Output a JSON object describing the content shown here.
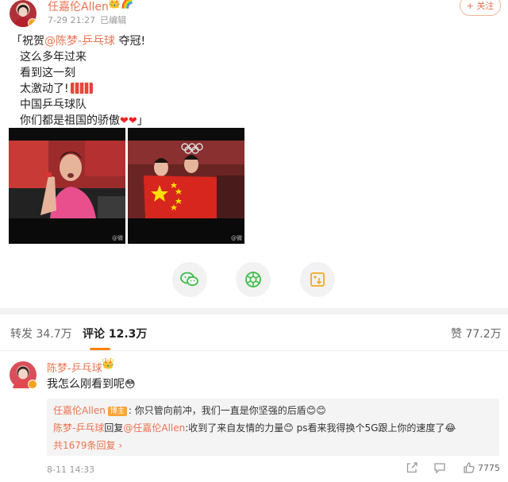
{
  "post": {
    "author": "任嘉伦Allen",
    "author_badges": "👑🌈",
    "time": "7-29 21:27",
    "edited": "已编辑",
    "follow_label": "+ 关注",
    "text_lines": [
      {
        "before": "「祝贺",
        "mention": "@陈梦-乒乓球",
        "after": " 夺冠!"
      },
      {
        "text": "这么多年过来"
      },
      {
        "text": "看到这一刻"
      },
      {
        "text": "太激动了!"
      },
      {
        "text": "中国乒乓球队"
      },
      {
        "text": "你们都是祖国的骄傲",
        "hearts": "❤❤",
        "close": "」"
      }
    ],
    "photos": [
      {
        "watermark": "@微"
      },
      {
        "watermark": "@微"
      }
    ]
  },
  "share": {
    "icons": [
      "wechat-icon",
      "moments-icon",
      "save-image-icon"
    ]
  },
  "tabs": {
    "repost": "转发 34.7万",
    "comment": "评论 12.3万",
    "like": "赞 77.2万"
  },
  "comment": {
    "author": "陈梦-乒乓球",
    "badge": "👑",
    "text": "我怎么刚看到呢",
    "emoji": "😳",
    "replies": [
      {
        "user": "任嘉伦Allen",
        "tag": "博主",
        "text": ": 你只管向前冲，我们一直是你坚强的后盾",
        "emoji": "😊😊"
      },
      {
        "user": "陈梦-乒乓球",
        "mid": "回复",
        "target": "@任嘉伦Allen",
        "text": ":收到了来自友情的力量",
        "emoji1": "😊",
        "text2": " ps看来我得换个5G跟上你的速度了",
        "emoji2": "😂"
      }
    ],
    "more_replies": "共1679条回复 ›",
    "time": "8-11 14:33",
    "like_count": "7775"
  },
  "colors": {
    "accent": "#eb7350",
    "orange": "#ff8200",
    "wechat_green": "#3fbc49"
  }
}
